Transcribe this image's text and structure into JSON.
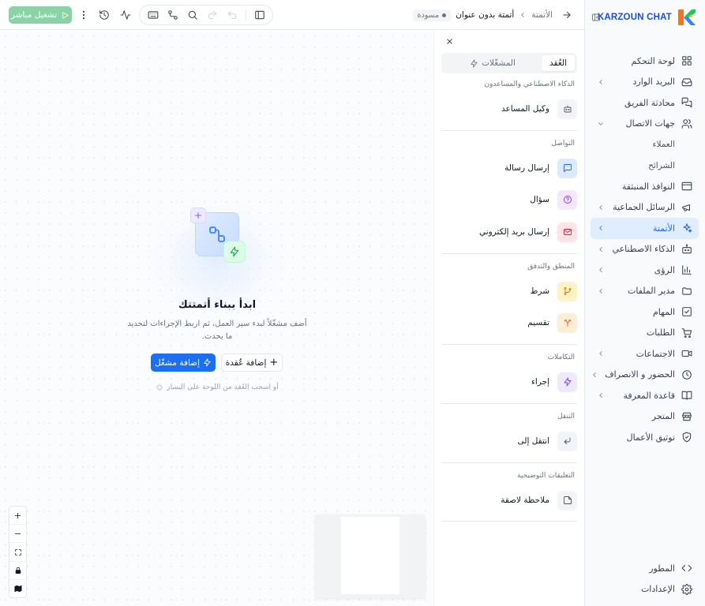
{
  "brand": {
    "name": "KARZOUN CHAT"
  },
  "sidebar": {
    "items": [
      {
        "label": "لوحة التحكم",
        "icon": "dashboard-icon"
      },
      {
        "label": "البريد الوارد",
        "icon": "inbox-icon",
        "chevron": true
      },
      {
        "label": "محادثة الفريق",
        "icon": "chat-icon"
      },
      {
        "label": "جهات الاتصال",
        "icon": "users-icon",
        "expanded": true
      },
      {
        "label": "العملاء",
        "sub": true
      },
      {
        "label": "الشرائح",
        "sub": true
      },
      {
        "label": "النوافذ المنبثقة",
        "icon": "popup-icon"
      },
      {
        "label": "الرسائل الجماعية",
        "icon": "megaphone-icon",
        "chevron": true
      },
      {
        "label": "الأتمتة",
        "icon": "automation-icon",
        "chevron": true,
        "active": true
      },
      {
        "label": "الذكاء الاصطناعي",
        "icon": "robot-icon",
        "chevron": true
      },
      {
        "label": "الرؤى",
        "icon": "chart-icon",
        "chevron": true
      },
      {
        "label": "مدير الملفات",
        "icon": "folder-icon",
        "chevron": true
      },
      {
        "label": "المهام",
        "icon": "task-icon"
      },
      {
        "label": "الطلبات",
        "icon": "cart-icon"
      },
      {
        "label": "الاجتماعات",
        "icon": "video-icon",
        "chevron": true
      },
      {
        "label": "الحضور و الانصراف",
        "icon": "clock-icon",
        "chevron": true
      },
      {
        "label": "قاعدة المعرفة",
        "icon": "book-icon",
        "chevron": true
      },
      {
        "label": "المتجر",
        "icon": "store-icon"
      },
      {
        "label": "توثيق الأعمال",
        "icon": "shield-icon"
      }
    ],
    "bottom": [
      {
        "label": "المطور",
        "icon": "code-icon"
      },
      {
        "label": "الإعدادات",
        "icon": "gear-icon"
      }
    ]
  },
  "topbar": {
    "breadcrumb_root": "الأتمتة",
    "breadcrumb_current": "أتمتة بدون عنوان",
    "status": "مسودة",
    "run_label": "تشغيل مباشر"
  },
  "canvas": {
    "empty_title": "ابدأ ببناء أتمتتك",
    "empty_desc": "أضف مشغّلاً لبدء سير العمل، ثم اربط الإجراءات لتحديد ما يحدث.",
    "add_trigger": "إضافة مشغّل",
    "add_node": "إضافة عُقدة",
    "drag_hint": "أو اسحب العُقد من اللوحة على اليسار"
  },
  "panel": {
    "tab_nodes": "العُقد",
    "tab_triggers": "المشغّلات",
    "sections": [
      {
        "title": "الذكاء الاصطناعي والمساعدون",
        "nodes": [
          {
            "label": "وكيل المساعد",
            "icon": "bot-icon",
            "color": "#f3f4f6",
            "fg": "#4b5563"
          }
        ]
      },
      {
        "title": "التواصل",
        "nodes": [
          {
            "label": "إرسال رسالة",
            "icon": "message-icon",
            "color": "#dbeafe",
            "fg": "#2563eb"
          },
          {
            "label": "سؤال",
            "icon": "question-icon",
            "color": "#f3e8ff",
            "fg": "#9333ea"
          },
          {
            "label": "إرسال بريد إلكتروني",
            "icon": "mail-icon",
            "color": "#ffe4e6",
            "fg": "#e11d48"
          }
        ]
      },
      {
        "title": "المنطق والتدفق",
        "nodes": [
          {
            "label": "شرط",
            "icon": "branch-icon",
            "color": "#fef3c7",
            "fg": "#d97706"
          },
          {
            "label": "تقسيم",
            "icon": "split-icon",
            "color": "#ffedd5",
            "fg": "#ea580c"
          }
        ]
      },
      {
        "title": "التكاملات",
        "nodes": [
          {
            "label": "إجراء",
            "icon": "bolt-icon",
            "color": "#ede9fe",
            "fg": "#7c3aed"
          }
        ]
      },
      {
        "title": "التنقل",
        "nodes": [
          {
            "label": "انتقل إلى",
            "icon": "goto-icon",
            "color": "#f1f5f9",
            "fg": "#475569"
          }
        ]
      },
      {
        "title": "التعليقات التوضيحية",
        "nodes": [
          {
            "label": "ملاحظة لاصقة",
            "icon": "note-icon",
            "color": "#f3f4f6",
            "fg": "#4b5563"
          }
        ]
      }
    ]
  }
}
